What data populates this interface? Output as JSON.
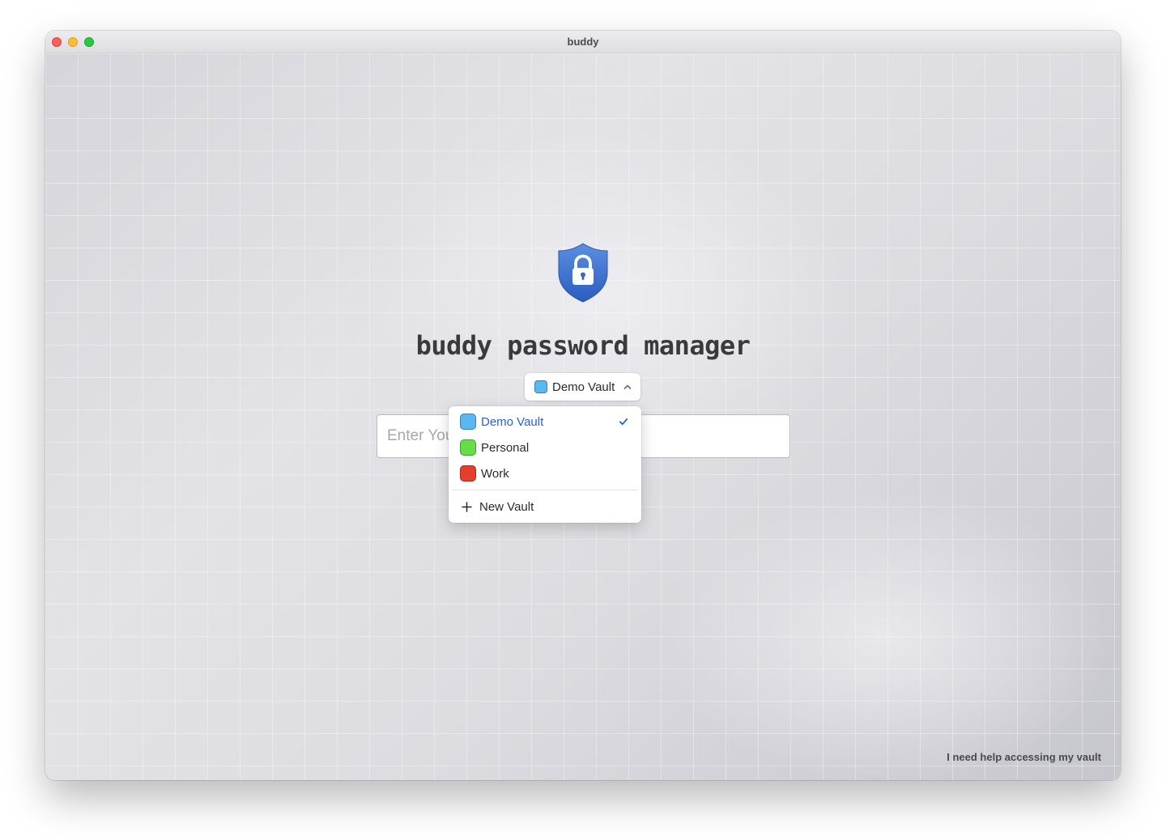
{
  "window": {
    "title": "buddy"
  },
  "app": {
    "title": "buddy password manager"
  },
  "vault_select": {
    "selected_label": "Demo Vault",
    "selected_color": "#5ab8f0"
  },
  "password_input": {
    "placeholder": "Enter Your Password"
  },
  "dropdown": {
    "items": [
      {
        "label": "Demo Vault",
        "color": "#5ab8f0",
        "selected": true
      },
      {
        "label": "Personal",
        "color": "#66de45",
        "selected": false
      },
      {
        "label": "Work",
        "color": "#e43f2a",
        "selected": false
      }
    ],
    "new_vault_label": "New Vault"
  },
  "footer": {
    "help_link": "I need help accessing my vault"
  },
  "icons": {
    "shield": "shield-lock-icon",
    "chevron": "chevron-up-icon",
    "check": "checkmark-icon",
    "plus": "plus-icon"
  },
  "colors": {
    "accent": "#2563d9",
    "shield_top": "#5b8fe0",
    "shield_bottom": "#2b5cc0"
  }
}
